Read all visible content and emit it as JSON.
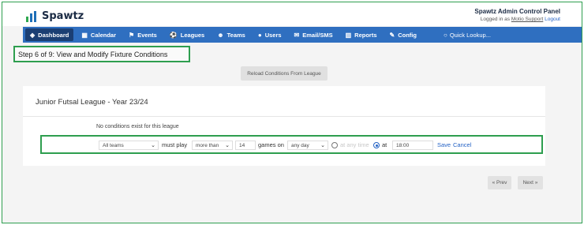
{
  "header": {
    "app_name": "Spawtz",
    "admin_title": "Spawtz Admin Control Panel",
    "logged_in_prefix": "Logged in as",
    "user": "Motio Support",
    "logout": "Logout"
  },
  "nav": {
    "items": [
      {
        "label": "Dashboard",
        "icon": "dashboard-icon"
      },
      {
        "label": "Calendar",
        "icon": "calendar-icon"
      },
      {
        "label": "Events",
        "icon": "events-icon"
      },
      {
        "label": "Leagues",
        "icon": "leagues-icon"
      },
      {
        "label": "Teams",
        "icon": "teams-icon"
      },
      {
        "label": "Users",
        "icon": "users-icon"
      },
      {
        "label": "Email/SMS",
        "icon": "email-icon"
      },
      {
        "label": "Reports",
        "icon": "reports-icon"
      },
      {
        "label": "Config",
        "icon": "wrench-icon"
      }
    ],
    "quick_lookup": "Quick Lookup..."
  },
  "step_title": "Step 6 of 9: View and Modify Fixture Conditions",
  "reload_button": "Reload Conditions From League",
  "league_title": "Junior Futsal League - Year 23/24",
  "no_conditions": "No conditions exist for this league",
  "condition": {
    "team": "All teams",
    "must_play": "must play",
    "comparator": "more than",
    "count": "14",
    "games_on": "games on",
    "day": "any day",
    "any_time": "at any time",
    "at": "at",
    "time": "18:00",
    "save": "Save",
    "cancel": "Cancel"
  },
  "pager": {
    "prev": "« Prev",
    "next": "Next »"
  },
  "colors": {
    "nav": "#2f6fc0",
    "nav_active": "#1b3f73",
    "highlight": "#2e9e4f",
    "link": "#2563c5"
  }
}
